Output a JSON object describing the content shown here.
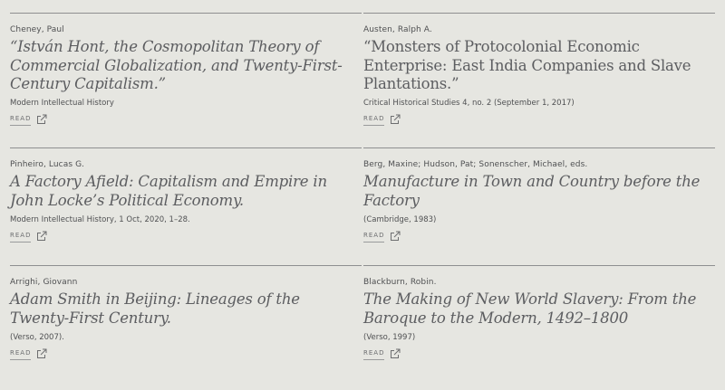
{
  "read_label": "READ",
  "entries": [
    {
      "author": "Cheney, Paul",
      "title": "“István Hont, the Cosmopolitan Theory of Commercial Globalization, and Twenty-First-Century Capitalism.”",
      "source": "Modern Intellectual History"
    },
    {
      "author": "Austen, Ralph A.",
      "title": "“Monsters of Protocolonial Economic Enterprise: East India Companies and Slave Plantations.”",
      "source": "Critical Historical Studies 4, no. 2 (September 1, 2017)"
    },
    {
      "author": "Pinheiro, Lucas G.",
      "title": "A Factory Afield: Capitalism and Empire in John Locke’s Political Economy.",
      "source": "Modern Intellectual History, 1 Oct, 2020, 1–28."
    },
    {
      "author": "Berg, Maxine; Hudson, Pat; Sonenscher, Michael, eds.",
      "title": "Manufacture in Town and Country before the Factory",
      "source": "(Cambridge, 1983)"
    },
    {
      "author": "Arrighi, Giovann",
      "title": "Adam Smith in Beijing: Lineages of the Twenty-First Century.",
      "source": "(Verso, 2007)."
    },
    {
      "author": "Blackburn, Robin.",
      "title": "The Making of New World Slavery: From the Baroque to the Modern, 1492–1800",
      "source": "(Verso, 1997)"
    }
  ],
  "icons": {
    "read_link": "external-link-icon"
  },
  "colors": {
    "background": "#e6e6e1",
    "text": "#57585a",
    "rule": "#8e8f90"
  }
}
